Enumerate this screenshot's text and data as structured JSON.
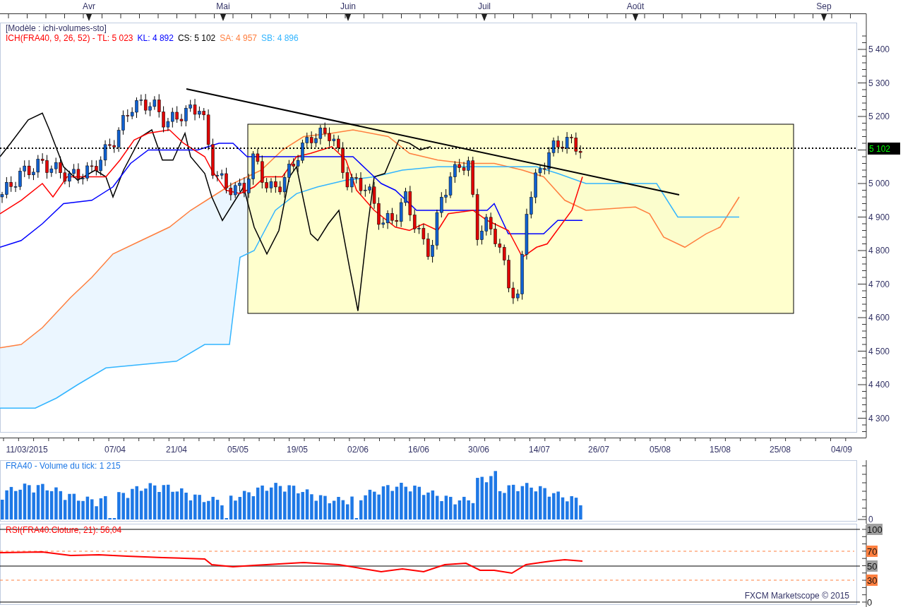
{
  "top_axis": {
    "months": [
      "Avr",
      "Mai",
      "Juin",
      "Juil",
      "Août",
      "Sep"
    ]
  },
  "price_panel": {
    "model_label": "[Modèle : ichi-volumes-sto]",
    "legend": [
      {
        "text": "ICH(FRA40, 9, 26, 52) -  TL: 5 023",
        "color": "#ff0000"
      },
      {
        "text": "KL: 4 892",
        "color": "#0000ff"
      },
      {
        "text": "CS: 5 102",
        "color": "#000000"
      },
      {
        "text": "SA: 4 957",
        "color": "#ff7f3f"
      },
      {
        "text": "SB: 4 896",
        "color": "#33b5ff"
      }
    ],
    "price_axis": [
      "5 400",
      "5 300",
      "5 200",
      "5 000",
      "4 900",
      "4 800",
      "4 700",
      "4 600",
      "4 500",
      "4 400",
      "4 300"
    ],
    "current_price": "5 102"
  },
  "date_axis": [
    "11/03/2015",
    "07/04",
    "21/04",
    "05/05",
    "19/05",
    "02/06",
    "16/06",
    "30/06",
    "14/07",
    "26/07",
    "05/08",
    "15/08",
    "25/08",
    "04/09"
  ],
  "volume_panel": {
    "label": "FRA40 - Volume du tick: 1 215",
    "axis": [
      "0"
    ]
  },
  "rsi_panel": {
    "label": "RSI(FRA40.Cloture, 21): 56,04",
    "axis": [
      {
        "label": "100",
        "color": "#a0a0a0"
      },
      {
        "label": "70",
        "color": "#ff7f3f"
      },
      {
        "label": "50",
        "color": "#a0a0a0"
      },
      {
        "label": "30",
        "color": "#ff7f3f"
      },
      {
        "label": "0"
      }
    ]
  },
  "copyright": "FXCM Marketscope © 2015"
}
